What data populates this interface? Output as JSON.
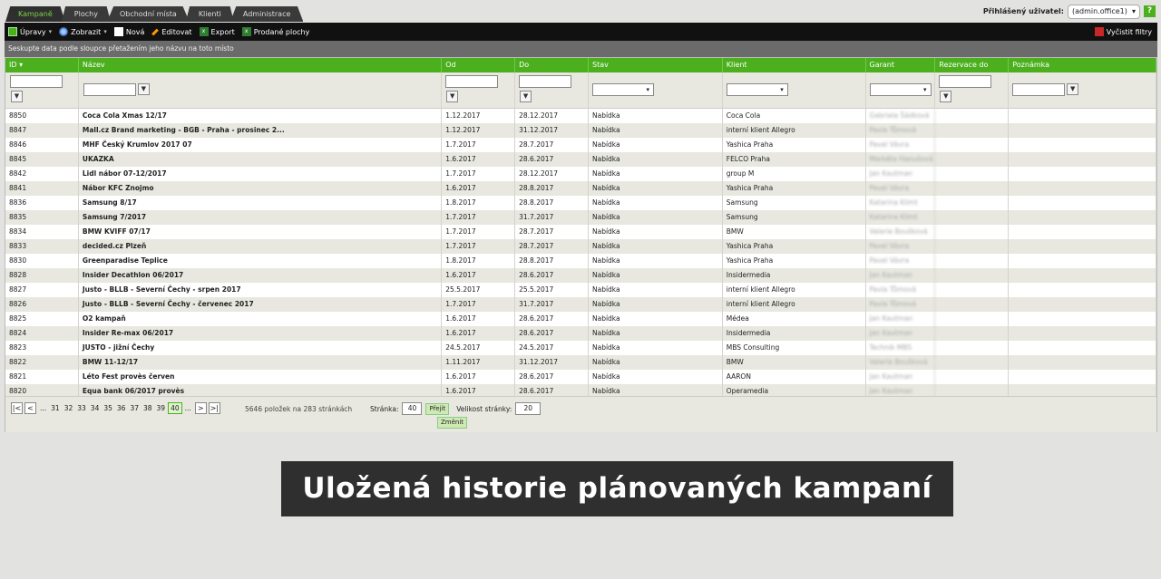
{
  "tabs": [
    "Kampaně",
    "Plochy",
    "Obchodní místa",
    "Klienti",
    "Administrace"
  ],
  "user": {
    "label": "Přihlášený uživatel:",
    "value": "(admin.office1)",
    "help": "?"
  },
  "toolbar": {
    "upravy": "Úpravy",
    "zobrazit": "Zobrazit",
    "nova": "Nová",
    "editovat": "Editovat",
    "export": "Export",
    "prodane": "Prodané plochy",
    "vycistit": "Vyčistit filtry"
  },
  "group_hint": "Seskupte data podle sloupce přetažením jeho názvu na toto místo",
  "columns": [
    "ID",
    "Název",
    "Od",
    "Do",
    "Stav",
    "Klient",
    "Garant",
    "Rezervace do",
    "Poznámka"
  ],
  "rows": [
    [
      "8850",
      "Coca Cola Xmas 12/17",
      "1.12.2017",
      "28.12.2017",
      "Nabídka",
      "Coca Cola",
      "Gabriela Šádková"
    ],
    [
      "8847",
      "Mall.cz Brand marketing - BGB - Praha - prosinec 2...",
      "1.12.2017",
      "31.12.2017",
      "Nabídka",
      "interní klient Allegro",
      "Pavla Tůmová"
    ],
    [
      "8846",
      "MHF Český Krumlov 2017 07",
      "1.7.2017",
      "28.7.2017",
      "Nabídka",
      "Yashica Praha",
      "Pavel Vávra"
    ],
    [
      "8845",
      "UKAZKA",
      "1.6.2017",
      "28.6.2017",
      "Nabídka",
      "FELCO Praha",
      "Markéta Hanušová"
    ],
    [
      "8842",
      "Lidl nábor 07-12/2017",
      "1.7.2017",
      "28.12.2017",
      "Nabídka",
      "group M",
      "Jan Kautman"
    ],
    [
      "8841",
      "Nábor KFC Znojmo",
      "1.6.2017",
      "28.8.2017",
      "Nabídka",
      "Yashica Praha",
      "Pavel Vávra"
    ],
    [
      "8836",
      "Samsung 8/17",
      "1.8.2017",
      "28.8.2017",
      "Nabídka",
      "Samsung",
      "Katarina Klimt"
    ],
    [
      "8835",
      "Samsung 7/2017",
      "1.7.2017",
      "31.7.2017",
      "Nabídka",
      "Samsung",
      "Katarina Klimt"
    ],
    [
      "8834",
      "BMW KVIFF 07/17",
      "1.7.2017",
      "28.7.2017",
      "Nabídka",
      "BMW",
      "Valerie Boušková"
    ],
    [
      "8833",
      "decided.cz Plzeň",
      "1.7.2017",
      "28.7.2017",
      "Nabídka",
      "Yashica Praha",
      "Pavel Vávra"
    ],
    [
      "8830",
      "Greenparadise Teplice",
      "1.8.2017",
      "28.8.2017",
      "Nabídka",
      "Yashica Praha",
      "Pavel Vávra"
    ],
    [
      "8828",
      "Insider Decathlon 06/2017",
      "1.6.2017",
      "28.6.2017",
      "Nabídka",
      "Insidermedia",
      "Jan Kautman"
    ],
    [
      "8827",
      "Justo - BLLB - Severní Čechy - srpen 2017",
      "25.5.2017",
      "25.5.2017",
      "Nabídka",
      "interní klient Allegro",
      "Pavla Tůmová"
    ],
    [
      "8826",
      "Justo - BLLB - Severní Čechy - červenec 2017",
      "1.7.2017",
      "31.7.2017",
      "Nabídka",
      "interní klient Allegro",
      "Pavla Tůmová"
    ],
    [
      "8825",
      "O2 kampaň",
      "1.6.2017",
      "28.6.2017",
      "Nabídka",
      "Médea",
      "Jan Kautman"
    ],
    [
      "8824",
      "Insider Re-max 06/2017",
      "1.6.2017",
      "28.6.2017",
      "Nabídka",
      "Insidermedia",
      "Jan Kautman"
    ],
    [
      "8823",
      "JUSTO - jižní Čechy",
      "24.5.2017",
      "24.5.2017",
      "Nabídka",
      "MBS Consulting",
      "Technik MBS"
    ],
    [
      "8822",
      "BMW 11-12/17",
      "1.11.2017",
      "31.12.2017",
      "Nabídka",
      "BMW",
      "Valerie Boušková"
    ],
    [
      "8821",
      "Léto Fest provès červen",
      "1.6.2017",
      "28.6.2017",
      "Nabídka",
      "AARON",
      "Jan Kautman"
    ],
    [
      "8820",
      "Equa bank 06/2017 provès",
      "1.6.2017",
      "28.6.2017",
      "Nabídka",
      "Operamedia",
      "Jan Kautman"
    ]
  ],
  "pager": {
    "pages": [
      "...",
      "31",
      "32",
      "33",
      "34",
      "35",
      "36",
      "37",
      "38",
      "39",
      "40",
      "..."
    ],
    "info": "5646 položek na 283 stránkách",
    "page_label": "Stránka:",
    "page_value": "40",
    "go": "Přejít",
    "size_label": "Velikost stránky:",
    "size_value": "20",
    "change": "Změnit"
  },
  "banner": "Uložená historie plánovaných kampaní",
  "colors": {
    "accent": "#4caf1e",
    "dark": "#2f2f2f",
    "toolbar": "#111111"
  }
}
